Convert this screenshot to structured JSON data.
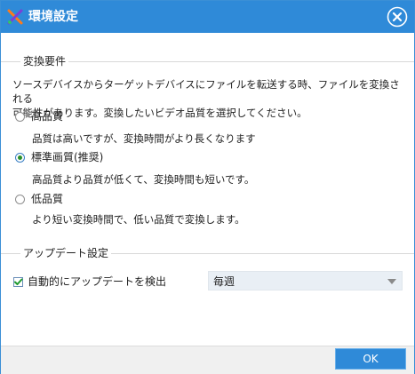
{
  "window": {
    "title": "環境設定",
    "app_icon": "scissors-x-icon",
    "close_icon": "close-icon",
    "title_bar_color": "#2f8ad8"
  },
  "conversion": {
    "section_title": "変換要件",
    "description_line1": "ソースデバイスからターゲットデバイスにファイルを転送する時、ファイルを変換される",
    "description_line2": "可能性があります。変換したいビデオ品質を選択してください。",
    "options": [
      {
        "label": "高品質",
        "description": "品質は高いですが、変換時間がより長くなります",
        "selected": false
      },
      {
        "label": "標準画質(推奨)",
        "description": "高品質より品質が低くて、変換時間も短いです。",
        "selected": true
      },
      {
        "label": "低品質",
        "description": "より短い変換時間で、低い品質で変換します。",
        "selected": false
      }
    ]
  },
  "update": {
    "section_title": "アップデート設定",
    "auto_check_label": "自動的にアップデートを検出",
    "auto_check_checked": true,
    "frequency_value": "毎週"
  },
  "footer": {
    "ok_label": "OK",
    "accent_color": "#2f8ad8"
  }
}
